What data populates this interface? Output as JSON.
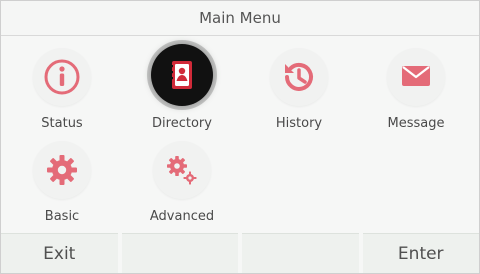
{
  "title": "Main Menu",
  "menu": [
    {
      "label": "Status",
      "icon": "info-icon"
    },
    {
      "label": "Directory",
      "icon": "directory-icon",
      "selected": true
    },
    {
      "label": "History",
      "icon": "history-icon"
    },
    {
      "label": "Message",
      "icon": "message-icon"
    },
    {
      "label": "Basic",
      "icon": "gear-icon"
    },
    {
      "label": "Advanced",
      "icon": "gears-icon"
    }
  ],
  "softkeys": [
    "Exit",
    "",
    "",
    "Enter"
  ],
  "colors": {
    "accent": "#e46b78",
    "selected_ring": "#111111",
    "text": "#4a4a4a"
  }
}
